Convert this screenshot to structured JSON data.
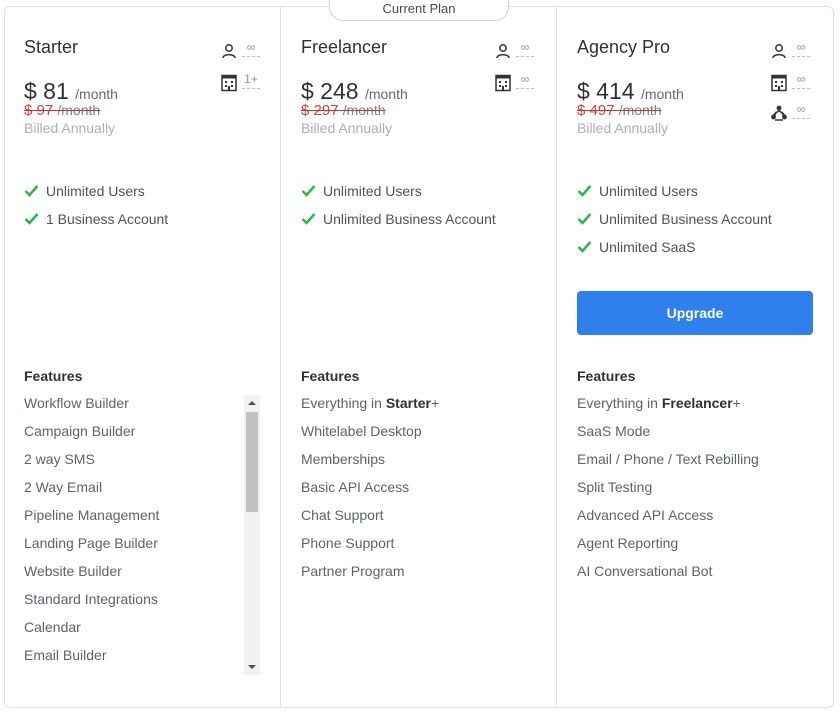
{
  "current_plan_label": "Current Plan",
  "accent_color": "#2f80ed",
  "check_color": "#2db84d",
  "plans": [
    {
      "name": "Starter",
      "price": "$ 81",
      "per": "/month",
      "old_price": "$ 97",
      "old_per": "/month",
      "billing": "Billed Annually",
      "meta": [
        {
          "icon": "user-icon",
          "value": "∞"
        },
        {
          "icon": "building-icon",
          "value": "1+"
        }
      ],
      "bullets": [
        "Unlimited Users",
        "1 Business Account"
      ],
      "features_title": "Features",
      "features": [
        "Workflow Builder",
        "Campaign Builder",
        "2 way SMS",
        "2 Way Email",
        "Pipeline Management",
        "Landing Page Builder",
        "Website Builder",
        "Standard Integrations",
        "Calendar",
        "Email Builder"
      ]
    },
    {
      "name": "Freelancer",
      "price": "$ 248",
      "per": "/month",
      "old_price": "$ 297",
      "old_per": "/month",
      "billing": "Billed Annually",
      "meta": [
        {
          "icon": "user-icon",
          "value": "∞"
        },
        {
          "icon": "building-icon",
          "value": "∞"
        }
      ],
      "bullets": [
        "Unlimited Users",
        "Unlimited Business Account"
      ],
      "features_title": "Features",
      "features_lead": {
        "prefix": "Everything in ",
        "bold": "Starter",
        "suffix": "+"
      },
      "features": [
        "Whitelabel Desktop",
        "Memberships",
        "Basic API Access",
        "Chat Support",
        "Phone Support",
        "Partner Program"
      ]
    },
    {
      "name": "Agency Pro",
      "price": "$ 414",
      "per": "/month",
      "old_price": "$ 497",
      "old_per": "/month",
      "billing": "Billed Annually",
      "meta": [
        {
          "icon": "user-icon",
          "value": "∞"
        },
        {
          "icon": "building-icon",
          "value": "∞"
        },
        {
          "icon": "network-icon",
          "value": "∞"
        }
      ],
      "bullets": [
        "Unlimited Users",
        "Unlimited Business Account",
        "Unlimited SaaS"
      ],
      "upgrade_label": "Upgrade",
      "features_title": "Features",
      "features_lead": {
        "prefix": "Everything in ",
        "bold": "Freelancer",
        "suffix": "+"
      },
      "features": [
        "SaaS Mode",
        "Email / Phone / Text Rebilling",
        "Split Testing",
        "Advanced API Access",
        "Agent Reporting",
        "AI Conversational Bot"
      ]
    }
  ]
}
